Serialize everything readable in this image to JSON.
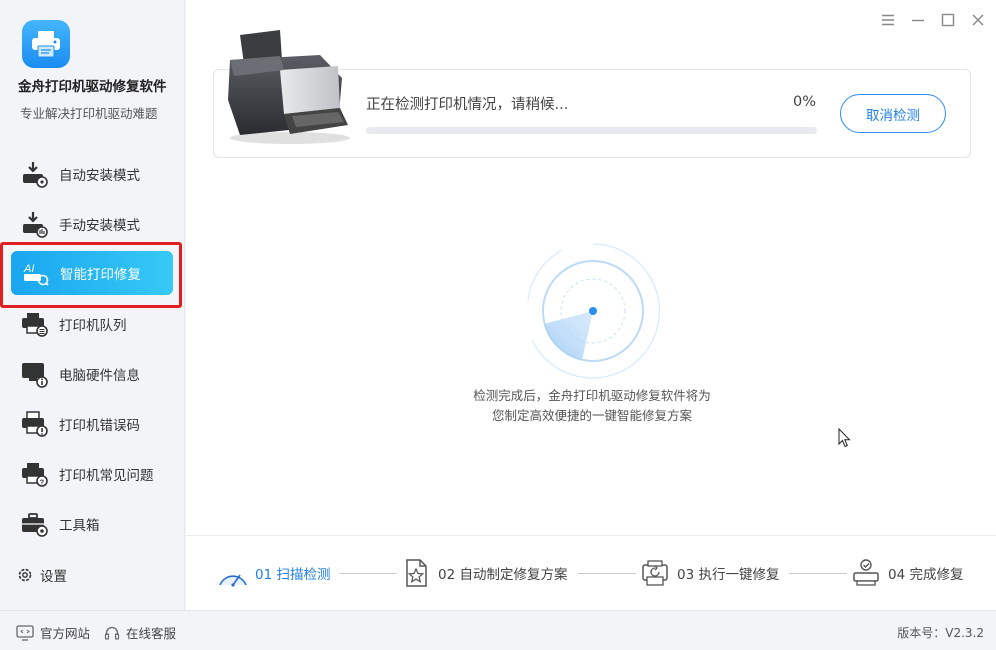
{
  "app": {
    "name": "金舟打印机驱动修复软件",
    "slogan": "专业解决打印机驱动难题",
    "version_label": "版本号：V2.3.2"
  },
  "sidebar": {
    "items": [
      {
        "label": "自动安装模式",
        "icon": "auto-install-icon"
      },
      {
        "label": "手动安装模式",
        "icon": "manual-install-icon"
      },
      {
        "label": "智能打印修复",
        "icon": "ai-repair-icon",
        "active": true
      },
      {
        "label": "打印机队列",
        "icon": "printer-queue-icon"
      },
      {
        "label": "电脑硬件信息",
        "icon": "hardware-info-icon"
      },
      {
        "label": "打印机错误码",
        "icon": "error-code-icon"
      },
      {
        "label": "打印机常见问题",
        "icon": "faq-icon"
      },
      {
        "label": "工具箱",
        "icon": "toolbox-icon"
      }
    ],
    "settings_label": "设置"
  },
  "footer": {
    "website_label": "官方网站",
    "support_label": "在线客服"
  },
  "status": {
    "text": "正在检测打印机情况，请稍候...",
    "percent_label": "0%",
    "progress": 0,
    "cancel_label": "取消检测"
  },
  "scan": {
    "caption_line1": "检测完成后，金舟打印机驱动修复软件将为",
    "caption_line2": "您制定高效便捷的一键智能修复方案"
  },
  "steps": [
    {
      "label": "01 扫描检测",
      "icon": "scan-icon",
      "active": true
    },
    {
      "label": "02 自动制定修复方案",
      "icon": "plan-document-icon"
    },
    {
      "label": "03 执行一键修复",
      "icon": "repair-printer-icon"
    },
    {
      "label": "04 完成修复",
      "icon": "complete-printer-icon"
    }
  ],
  "colors": {
    "accent": "#1f93ef",
    "active_gradient_start": "#1aa6f0",
    "active_gradient_end": "#36c9f5",
    "highlight": "#e02020"
  }
}
